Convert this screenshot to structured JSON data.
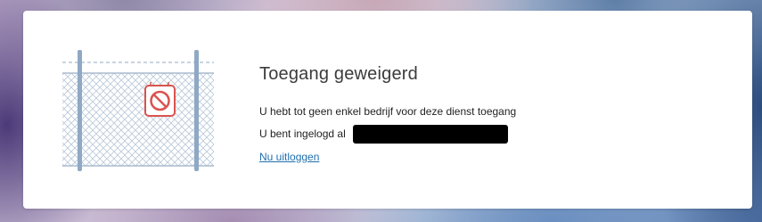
{
  "page": {
    "title": "Toegang geweigerd",
    "message_no_access": "U hebt tot geen enkel bedrijf voor deze dienst toegang",
    "logged_in_label": "U bent ingelogd al",
    "logged_in_value": "",
    "logout_link": "Nu uitloggen"
  },
  "illustration": {
    "icon": "no-entry-sign-icon",
    "sign_color": "#d9534f",
    "fence_color": "#8fa9c4"
  },
  "colors": {
    "link": "#1f6fb0",
    "title": "#3b3b3b",
    "card_background": "#ffffff"
  }
}
